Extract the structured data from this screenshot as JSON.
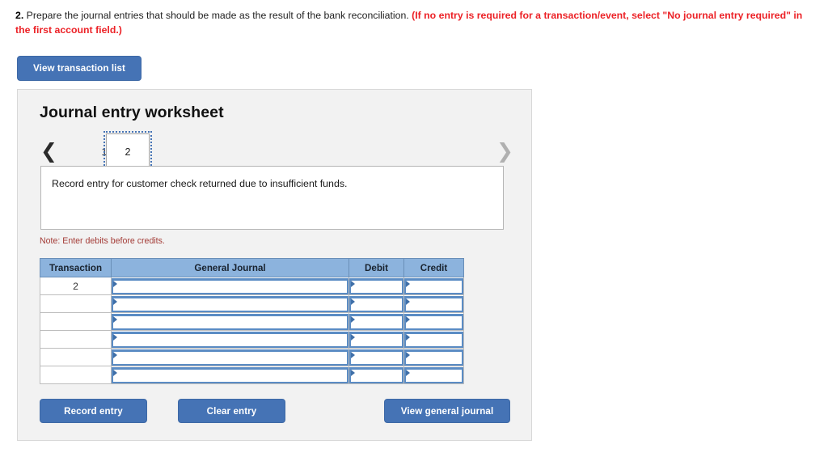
{
  "prompt": {
    "number": "2.",
    "body": " Prepare the journal entries that should be made as the result of the bank reconciliation. ",
    "hint": "(If no entry is required for a transaction/event, select \"No journal entry required\" in the first account field.)"
  },
  "toolbar": {
    "view_transaction_list_label": "View transaction list"
  },
  "worksheet": {
    "title": "Journal entry worksheet",
    "pager": {
      "prev_icon": "chevron-left-icon",
      "next_icon": "chevron-right-icon",
      "tabs": [
        {
          "label": "1",
          "selected": false
        },
        {
          "label": "2",
          "selected": true
        }
      ]
    },
    "description": "Record entry for customer check returned due to insufficient funds.",
    "note": "Note: Enter debits before credits.",
    "table": {
      "headers": [
        "Transaction",
        "General Journal",
        "Debit",
        "Credit"
      ],
      "rows": [
        {
          "transaction": "2",
          "general_journal": "",
          "debit": "",
          "credit": ""
        },
        {
          "transaction": "",
          "general_journal": "",
          "debit": "",
          "credit": ""
        },
        {
          "transaction": "",
          "general_journal": "",
          "debit": "",
          "credit": ""
        },
        {
          "transaction": "",
          "general_journal": "",
          "debit": "",
          "credit": ""
        },
        {
          "transaction": "",
          "general_journal": "",
          "debit": "",
          "credit": ""
        },
        {
          "transaction": "",
          "general_journal": "",
          "debit": "",
          "credit": ""
        }
      ]
    },
    "actions": {
      "record_entry_label": "Record entry",
      "clear_entry_label": "Clear entry",
      "view_general_journal_label": "View general journal"
    }
  },
  "colors": {
    "button_blue": "#4573b5",
    "table_header_blue": "#8cb3dd",
    "input_border_blue": "#5b8cc4",
    "hint_red": "#ec2227",
    "note_red": "#a33b36",
    "panel_bg": "#f2f2f2"
  }
}
